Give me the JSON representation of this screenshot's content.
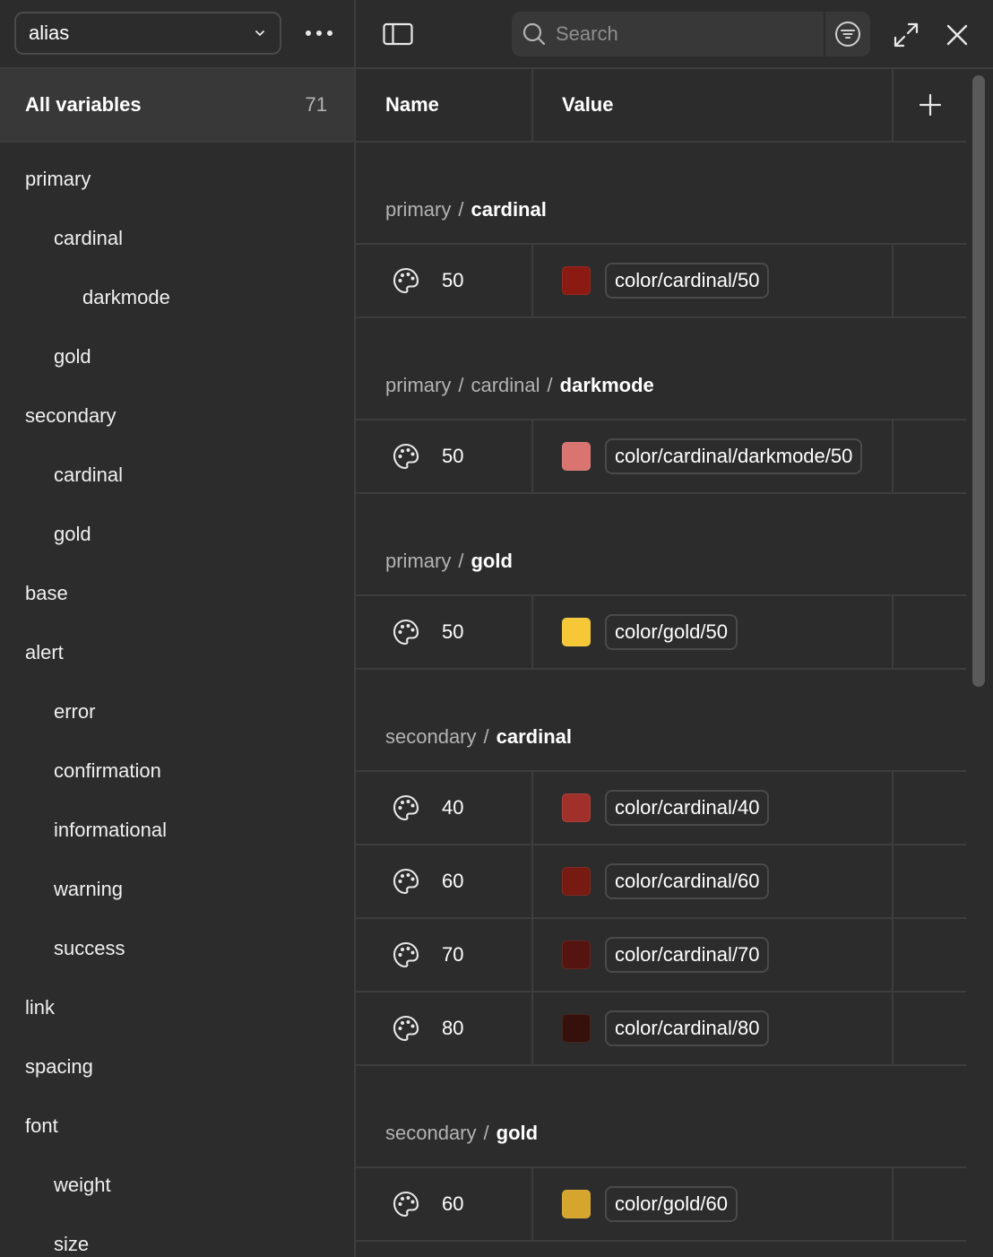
{
  "sidebar": {
    "collection": "alias",
    "all_variables_label": "All variables",
    "all_variables_count": "71",
    "groups": [
      {
        "label": "primary",
        "level": 0
      },
      {
        "label": "cardinal",
        "level": 1
      },
      {
        "label": "darkmode",
        "level": 2
      },
      {
        "label": "gold",
        "level": 1
      },
      {
        "label": "secondary",
        "level": 0
      },
      {
        "label": "cardinal",
        "level": 1
      },
      {
        "label": "gold",
        "level": 1
      },
      {
        "label": "base",
        "level": 0
      },
      {
        "label": "alert",
        "level": 0
      },
      {
        "label": "error",
        "level": 1
      },
      {
        "label": "confirmation",
        "level": 1
      },
      {
        "label": "informational",
        "level": 1
      },
      {
        "label": "warning",
        "level": 1
      },
      {
        "label": "success",
        "level": 1
      },
      {
        "label": "link",
        "level": 0
      },
      {
        "label": "spacing",
        "level": 0
      },
      {
        "label": "font",
        "level": 0
      },
      {
        "label": "weight",
        "level": 1
      },
      {
        "label": "size",
        "level": 1
      }
    ]
  },
  "toolbar": {
    "search_placeholder": "Search"
  },
  "table": {
    "col_name": "Name",
    "col_value": "Value",
    "groups": [
      {
        "path": [
          "primary"
        ],
        "leaf": "cardinal",
        "rows": [
          {
            "name": "50",
            "color": "#8b1a12",
            "alias": "color/cardinal/50"
          }
        ]
      },
      {
        "path": [
          "primary",
          "cardinal"
        ],
        "leaf": "darkmode",
        "rows": [
          {
            "name": "50",
            "color": "#d97471",
            "alias": "color/cardinal/darkmode/50"
          }
        ]
      },
      {
        "path": [
          "primary"
        ],
        "leaf": "gold",
        "rows": [
          {
            "name": "50",
            "color": "#f6c737",
            "alias": "color/gold/50"
          }
        ]
      },
      {
        "path": [
          "secondary"
        ],
        "leaf": "cardinal",
        "rows": [
          {
            "name": "40",
            "color": "#a2302a",
            "alias": "color/cardinal/40"
          },
          {
            "name": "60",
            "color": "#771a12",
            "alias": "color/cardinal/60"
          },
          {
            "name": "70",
            "color": "#55140f",
            "alias": "color/cardinal/70"
          },
          {
            "name": "80",
            "color": "#36110c",
            "alias": "color/cardinal/80"
          }
        ]
      },
      {
        "path": [
          "secondary"
        ],
        "leaf": "gold",
        "rows": [
          {
            "name": "60",
            "color": "#d6a52d",
            "alias": "color/gold/60"
          }
        ]
      }
    ]
  },
  "icons": {
    "row_type": "palette-icon",
    "dropdown": "chevron-down-icon",
    "more": "more-horizontal-icon",
    "sidebar_toggle": "sidebar-toggle-icon",
    "search": "search-icon",
    "filter": "filter-icon",
    "expand": "expand-icon",
    "close": "close-icon",
    "add": "plus-icon"
  }
}
